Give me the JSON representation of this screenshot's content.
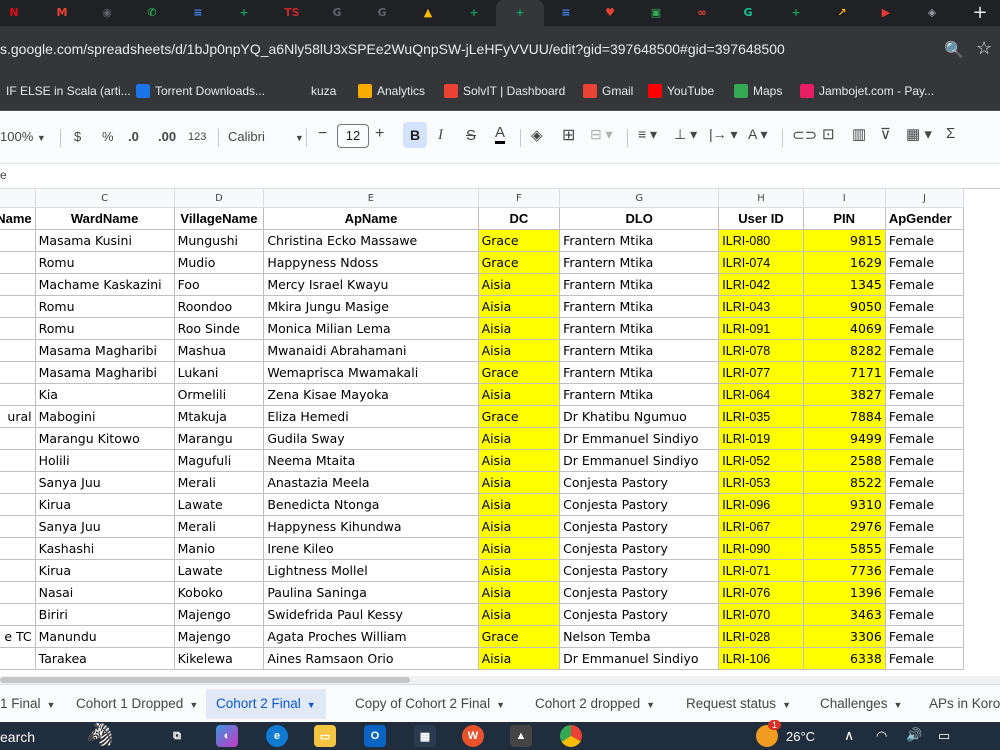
{
  "browser": {
    "url": "s.google.com/spreadsheets/d/1bJp0npYQ_a6Nly58lU3xSPEe2WuQnpSW-jLeHFyVVUU/edit?gid=397648500#gid=397648500",
    "new_tab_label": "+",
    "tab_icons": [
      {
        "name": "netflix-icon",
        "glyph": "N",
        "color": "#e50914"
      },
      {
        "name": "gmail-icon",
        "glyph": "M",
        "color": "#ea4335"
      },
      {
        "name": "classroom-icon",
        "glyph": "◉",
        "color": "#5f6368"
      },
      {
        "name": "whatsapp-icon",
        "glyph": "✆",
        "color": "#25d366"
      },
      {
        "name": "docs-icon",
        "glyph": "≡",
        "color": "#4285f4"
      },
      {
        "name": "sheets-icon",
        "glyph": "+",
        "color": "#0f9d58"
      },
      {
        "name": "ts-icon",
        "glyph": "TS",
        "color": "#c62828"
      },
      {
        "name": "google-icon",
        "glyph": "G",
        "color": "#5f6368"
      },
      {
        "name": "google-icon-2",
        "glyph": "G",
        "color": "#5f6368"
      },
      {
        "name": "drive-icon",
        "glyph": "▲",
        "color": "#fbbc04"
      },
      {
        "name": "sheets-icon-2",
        "glyph": "+",
        "color": "#0f9d58"
      },
      {
        "name": "sheets-icon-active",
        "glyph": "+",
        "color": "#0f9d58"
      },
      {
        "name": "docs-icon-2",
        "glyph": "≡",
        "color": "#4285f4"
      },
      {
        "name": "heart-icon",
        "glyph": "♥",
        "color": "#ea4335"
      },
      {
        "name": "calc-icon",
        "glyph": "▣",
        "color": "#34a853"
      },
      {
        "name": "link-icon",
        "glyph": "∞",
        "color": "#ea4335"
      },
      {
        "name": "grammarly-icon",
        "glyph": "G",
        "color": "#15c39a"
      },
      {
        "name": "sheets-icon-3",
        "glyph": "+",
        "color": "#0f9d58"
      },
      {
        "name": "analytics-icon",
        "glyph": "↗",
        "color": "#f9ab00"
      },
      {
        "name": "youtube-tab-icon",
        "glyph": "▶",
        "color": "#e53935"
      },
      {
        "name": "shield-icon",
        "glyph": "◈",
        "color": "#9aa0a6"
      }
    ],
    "bookmarks": [
      {
        "label": "IF ELSE in Scala (arti...",
        "icon": "scala-icon",
        "color": "#35363a"
      },
      {
        "label": "Torrent Downloads...",
        "icon": "torrent-icon",
        "color": "#1a73e8"
      },
      {
        "label": "kuza",
        "icon": "folder-icon",
        "color": "#35363a"
      },
      {
        "label": "Analytics",
        "icon": "analytics-icon",
        "color": "#f9ab00"
      },
      {
        "label": "SolvIT | Dashboard",
        "icon": "location-icon",
        "color": "#ea4335"
      },
      {
        "label": "Gmail",
        "icon": "gmail-icon",
        "color": "#ea4335"
      },
      {
        "label": "YouTube",
        "icon": "youtube-icon",
        "color": "#ff0000"
      },
      {
        "label": "Maps",
        "icon": "maps-icon",
        "color": "#34a853"
      },
      {
        "label": "Jambojet.com - Pay...",
        "icon": "jambojet-icon",
        "color": "#e91e63"
      }
    ]
  },
  "toolbar": {
    "zoom": "100%",
    "currency": "$",
    "percent": "%",
    "dec_decrease": ".0",
    "dec_increase": ".00",
    "format_123": "123",
    "font": "Calibri",
    "font_size": "12",
    "minus": "−",
    "plus": "+",
    "bold": "B",
    "italic": "I",
    "strike": "S",
    "textcolor": "A"
  },
  "formula_bar": {
    "text": "e"
  },
  "grid": {
    "col_letters": [
      "",
      "C",
      "D",
      "E",
      "F",
      "G",
      "H",
      "I",
      "J"
    ],
    "headers": [
      "Name",
      "WardName",
      "VillageName",
      "ApName",
      "DC",
      "DLO",
      "User ID",
      "PIN",
      "ApGender"
    ],
    "rows": [
      [
        "",
        "Masama Kusini",
        "Mungushi",
        "Christina Ecko Massawe",
        "Grace",
        "Frantern Mtika",
        "ILRI-080",
        "9815",
        "Female"
      ],
      [
        "",
        "Romu",
        "Mudio",
        "Happyness Ndoss",
        "Grace",
        "Frantern Mtika",
        "ILRI-074",
        "1629",
        "Female"
      ],
      [
        "",
        "Machame Kaskazini",
        "Foo",
        "Mercy Israel Kwayu",
        "Aisia",
        "Frantern Mtika",
        "ILRI-042",
        "1345",
        "Female"
      ],
      [
        "",
        "Romu",
        "Roondoo",
        "Mkira Jungu Masige",
        "Aisia",
        "Frantern Mtika",
        "ILRI-043",
        "9050",
        "Female"
      ],
      [
        "",
        "Romu",
        "Roo Sinde",
        "Monica Milian Lema",
        "Aisia",
        "Frantern Mtika",
        "ILRI-091",
        "4069",
        "Female"
      ],
      [
        "",
        "Masama Magharibi",
        "Mashua",
        "Mwanaidi Abrahamani",
        "Aisia",
        "Frantern Mtika",
        "ILRI-078",
        "8282",
        "Female"
      ],
      [
        "",
        "Masama Magharibi",
        "Lukani",
        "Wemaprisca Mwamakali",
        "Grace",
        "Frantern Mtika",
        "ILRI-077",
        "7171",
        "Female"
      ],
      [
        "",
        "Kia",
        "Ormelili",
        "Zena Kisae Mayoka",
        "Aisia",
        "Frantern Mtika",
        "ILRI-064",
        "3827",
        "Female"
      ],
      [
        "ural",
        "Mabogini",
        "Mtakuja",
        "Eliza Hemedi",
        "Grace",
        "Dr Khatibu Ngumuo",
        "ILRI-035",
        "7884",
        "Female"
      ],
      [
        "",
        "Marangu Kitowo",
        "Marangu",
        "Gudila Sway",
        "Aisia",
        "Dr Emmanuel Sindiyo",
        "ILRI-019",
        "9499",
        "Female"
      ],
      [
        "",
        "Holili",
        "Magufuli",
        "Neema Mtaita",
        "Aisia",
        "Dr Emmanuel Sindiyo",
        "ILRI-052",
        "2588",
        "Female"
      ],
      [
        "",
        "Sanya Juu",
        "Merali",
        "Anastazia Meela",
        "Aisia",
        "Conjesta Pastory",
        "ILRI-053",
        "8522",
        "Female"
      ],
      [
        "",
        "Kirua",
        "Lawate",
        "Benedicta Ntonga",
        "Aisia",
        "Conjesta Pastory",
        "ILRI-096",
        "9310",
        "Female"
      ],
      [
        "",
        "Sanya Juu",
        "Merali",
        "Happyness Kihundwa",
        "Aisia",
        "Conjesta Pastory",
        "ILRI-067",
        "2976",
        "Female"
      ],
      [
        "",
        "Kashashi",
        "Manio",
        "Irene Kileo",
        "Aisia",
        "Conjesta Pastory",
        "ILRI-090",
        "5855",
        "Female"
      ],
      [
        "",
        "Kirua",
        "Lawate",
        "Lightness Mollel",
        "Aisia",
        "Conjesta Pastory",
        "ILRI-071",
        "7736",
        "Female"
      ],
      [
        "",
        "Nasai",
        "Koboko",
        "Paulina Saninga",
        "Aisia",
        "Conjesta Pastory",
        "ILRI-076",
        "1396",
        "Female"
      ],
      [
        "",
        "Biriri",
        "Majengo",
        "Swidefrida Paul Kessy",
        "Aisia",
        "Conjesta Pastory",
        "ILRI-070",
        "3463",
        "Female"
      ],
      [
        "e TC",
        "Manundu",
        "Majengo",
        "Agata Proches William",
        "Grace",
        "Nelson Temba",
        "ILRI-028",
        "3306",
        "Female"
      ],
      [
        "",
        "Tarakea",
        "Kikelewa",
        "Aines Ramsaon Orio",
        "Aisia",
        "Dr Emmanuel Sindiyo",
        "ILRI-106",
        "6338",
        "Female"
      ]
    ]
  },
  "sheet_tabs": [
    {
      "label": "1 Final",
      "active": false
    },
    {
      "label": "Cohort 1 Dropped",
      "active": false
    },
    {
      "label": "Cohort 2 Final",
      "active": true
    },
    {
      "label": "Copy of Cohort 2 Final",
      "active": false
    },
    {
      "label": "Cohort 2 dropped",
      "active": false
    },
    {
      "label": "Request status",
      "active": false
    },
    {
      "label": "Challenges",
      "active": false
    },
    {
      "label": "APs in Koro",
      "active": false
    }
  ],
  "taskbar": {
    "search_label": "earch",
    "temperature": "26°C",
    "notification_count": "1"
  },
  "colors": {
    "highlight_yellow": "#ffff00",
    "active_tab_blue": "#0b57d0",
    "chrome_dark": "#35363a"
  }
}
